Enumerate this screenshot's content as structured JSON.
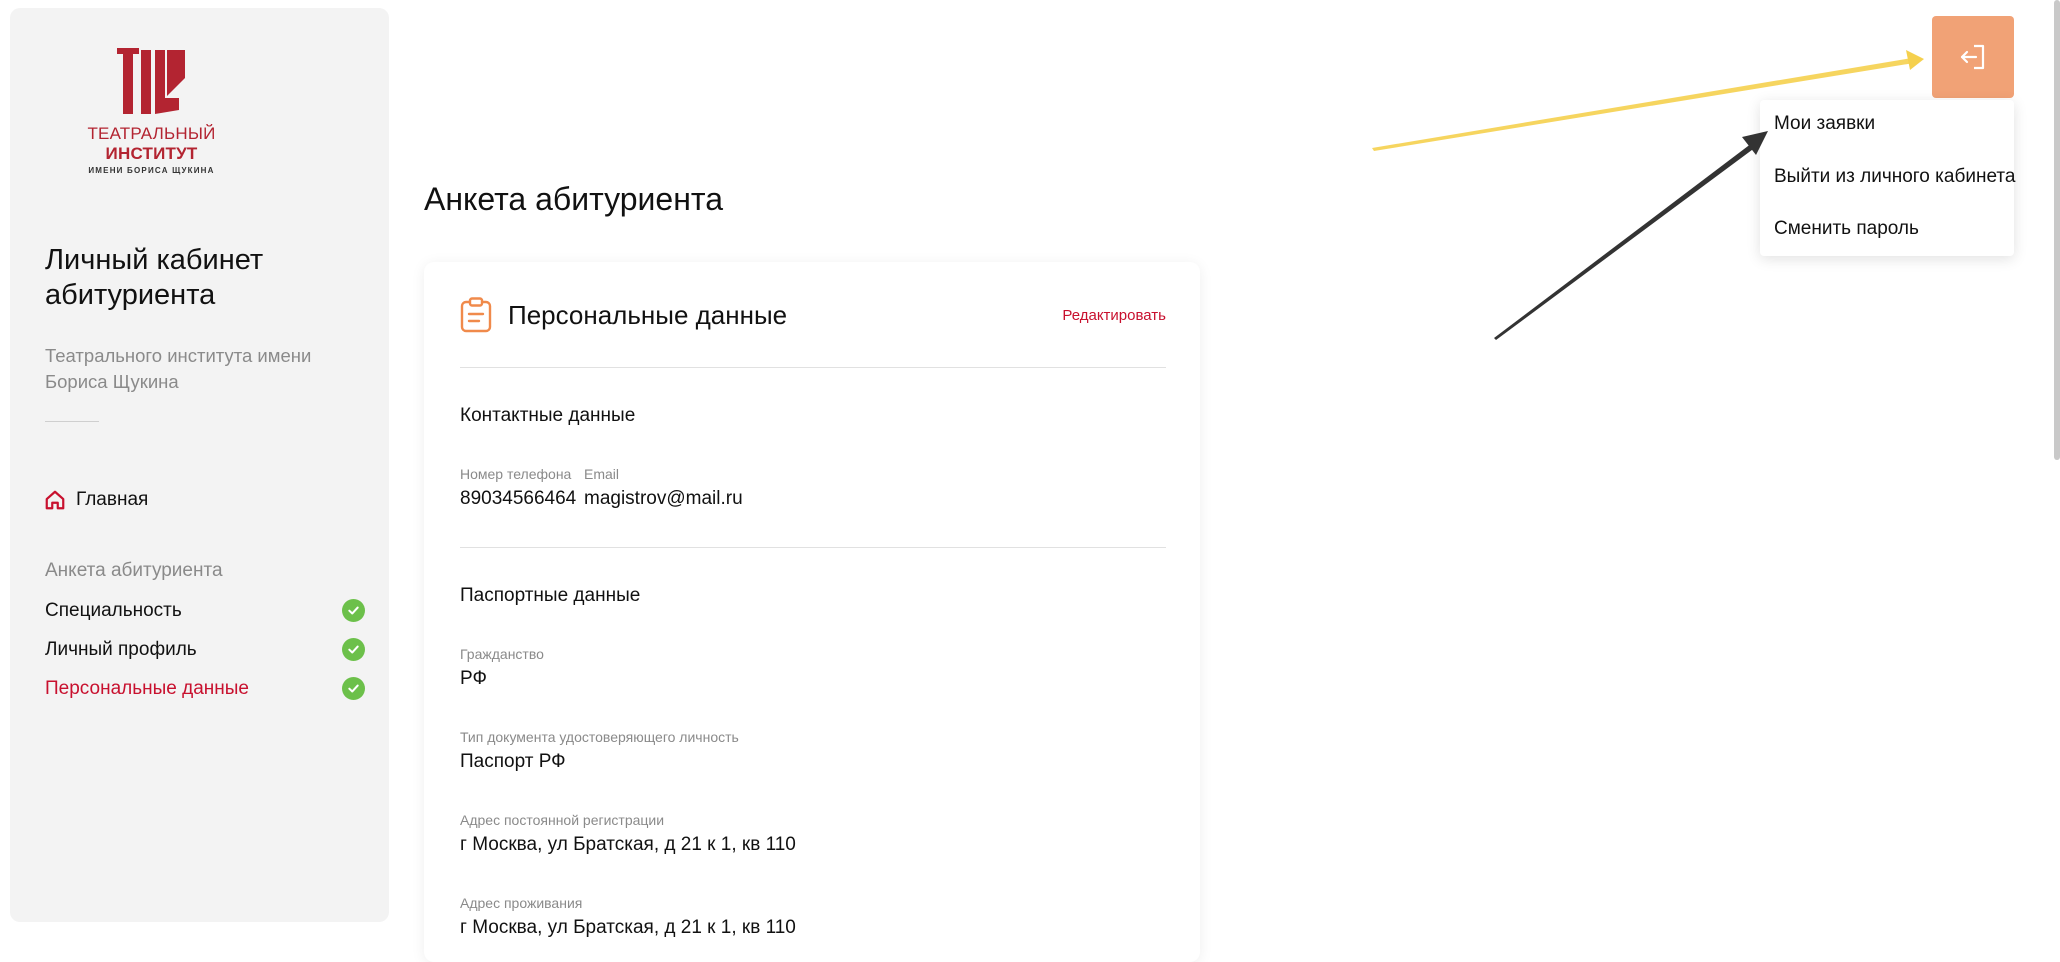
{
  "logo": {
    "line1_a": "ТЕАТРАЛЬНЫЙ ",
    "line1_b": "ИНСТИТУТ",
    "line2": "ИМЕНИ БОРИСА ЩУКИНА",
    "color": "#b32431"
  },
  "sidebar": {
    "title": "Личный кабинет абитуриента",
    "subtitle": "Театрального института имени Бориса Щукина",
    "home_label": "Главная",
    "home_icon": "home-icon",
    "section_label": "Анкета абитуриента",
    "items": [
      {
        "label": "Специальность",
        "status_icon": "check-circle-icon"
      },
      {
        "label": "Личный профиль",
        "status_icon": "check-circle-icon"
      },
      {
        "label": "Персональные данные",
        "status_icon": "check-circle-icon",
        "active": true
      }
    ]
  },
  "main": {
    "page_title": "Анкета абитуриента",
    "card": {
      "title": "Персональные данные",
      "icon": "clipboard-icon",
      "edit_label": "Редактировать",
      "contacts": {
        "title": "Контактные данные",
        "phone_label": "Номер телефона",
        "phone_value": "89034566464",
        "email_label": "Email",
        "email_value": "magistrov@mail.ru"
      },
      "passport": {
        "title": "Паспортные данные",
        "fields": [
          {
            "label": "Гражданство",
            "value": "РФ"
          },
          {
            "label": "Тип документа удостоверяющего личность",
            "value": "Паспорт РФ"
          },
          {
            "label": "Адрес постоянной регистрации",
            "value": "г Москва, ул Братская, д 21 к 1, кв 110"
          },
          {
            "label": "Адрес проживания",
            "value": "г Москва, ул Братская, д 21 к 1, кв 110"
          }
        ]
      }
    }
  },
  "topbar": {
    "logout_icon": "logout-icon",
    "menu": [
      {
        "label": "Мои заявки"
      },
      {
        "label": "Выйти из личного кабинета"
      },
      {
        "label": "Сменить пароль"
      }
    ]
  },
  "colors": {
    "accent": "#c8102e",
    "check": "#6cc04a",
    "logout_button": "#f1a276",
    "icon_orange": "#f08a4b",
    "arrow_yellow": "#f5d04e",
    "arrow_dark": "#333333"
  }
}
